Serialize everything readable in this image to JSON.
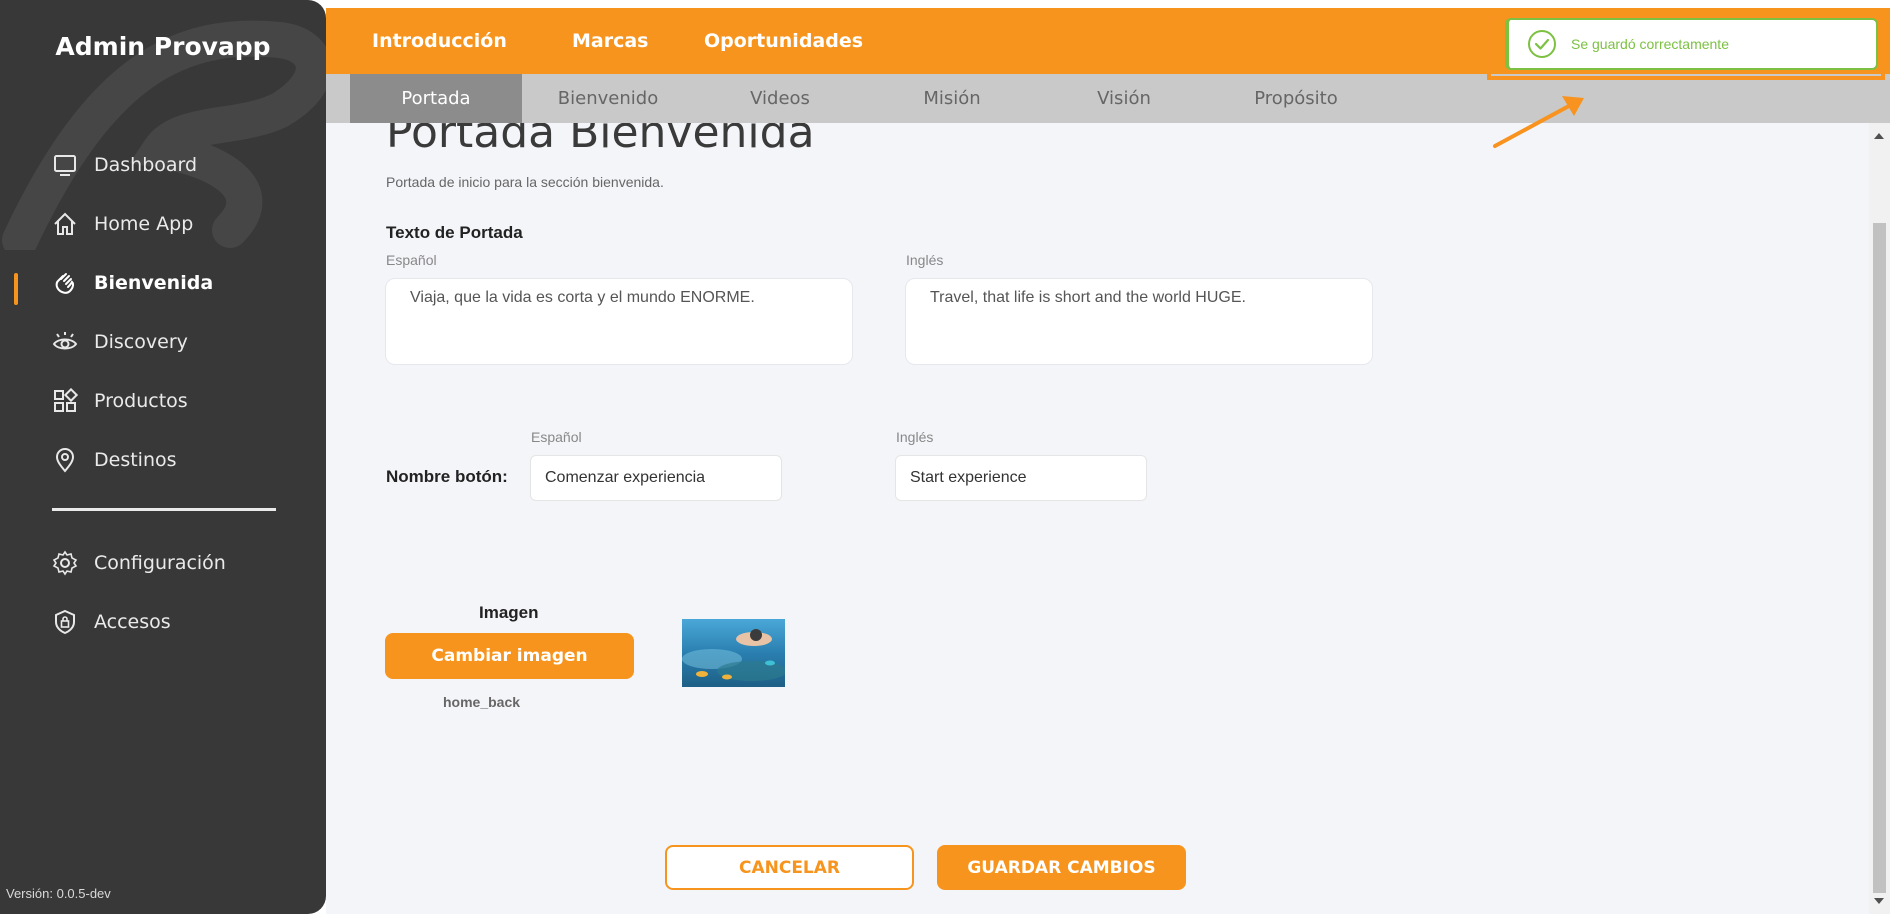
{
  "sidebar": {
    "app_title": "Admin Provapp",
    "items": [
      {
        "label": "Dashboard",
        "icon": "monitor-icon"
      },
      {
        "label": "Home App",
        "icon": "home-icon"
      },
      {
        "label": "Bienvenida",
        "icon": "waving-hand-icon",
        "active": true
      },
      {
        "label": "Discovery",
        "icon": "eye-icon"
      },
      {
        "label": "Productos",
        "icon": "shapes-icon"
      },
      {
        "label": "Destinos",
        "icon": "map-pin-icon"
      }
    ],
    "secondary_items": [
      {
        "label": "Configuración",
        "icon": "gear-icon"
      },
      {
        "label": "Accesos",
        "icon": "shield-lock-icon"
      }
    ],
    "version": "Versión: 0.0.5-dev"
  },
  "topbar": {
    "tabs": [
      "Introducción",
      "Marcas",
      "Oportunidades"
    ],
    "active_tab": "Introducción"
  },
  "subtabs": {
    "items": [
      "Portada",
      "Bienvenido",
      "Videos",
      "Misión",
      "Visión",
      "Propósito"
    ],
    "active": "Portada"
  },
  "page": {
    "title": "Portada Bienvenida",
    "subtitle": "Portada de inicio para la sección bienvenida.",
    "cover_text": {
      "section_label": "Texto de Portada",
      "es_label": "Español",
      "en_label": "Inglés",
      "es_value": "Viaja, que la vida es corta y el mundo ENORME.",
      "en_value": "Travel, that life is short and the world HUGE."
    },
    "button_name": {
      "section_label": "Nombre botón:",
      "es_label": "Español",
      "en_label": "Inglés",
      "es_value": "Comenzar experiencia",
      "en_value": "Start experience"
    },
    "image": {
      "label": "Imagen",
      "change_button": "Cambiar imagen",
      "file_name": "home_back"
    },
    "actions": {
      "cancel": "CANCELAR",
      "save": "GUARDAR CAMBIOS"
    }
  },
  "toast": {
    "message": "Se guardó correctamente",
    "icon": "check-circle-icon"
  },
  "colors": {
    "accent": "#f7941d",
    "sidebar_bg": "#383838",
    "success": "#7cc142",
    "main_bg": "#f4f5f9"
  }
}
